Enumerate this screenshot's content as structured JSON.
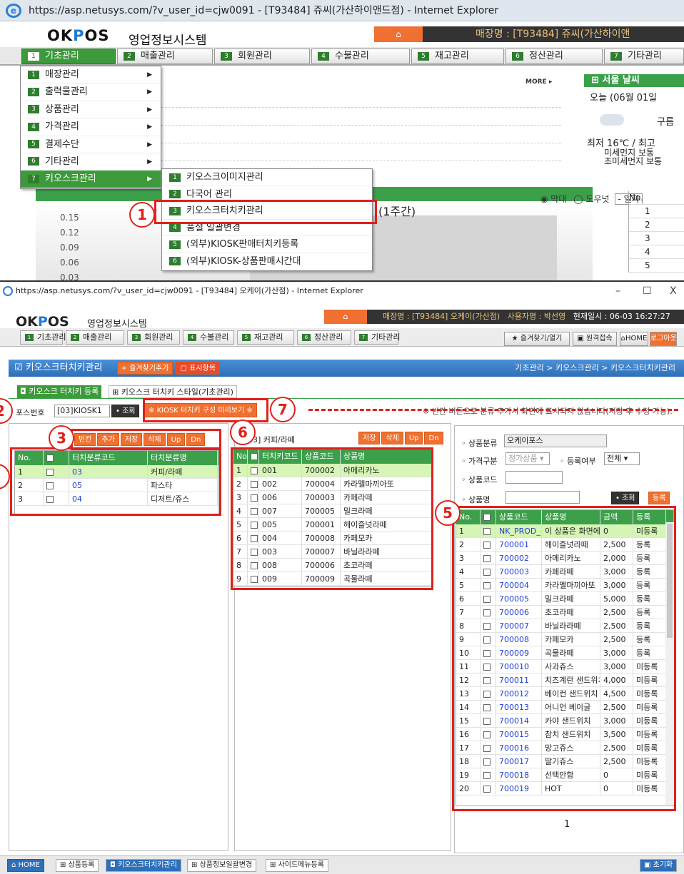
{
  "top_window": {
    "title": "https://asp.netusys.com/?v_user_id=cjw0091 - [T93484] 쥬씨(가산하이앤드점) - Internet Explorer",
    "logo_brand": "OKPOS",
    "logo_sub": "영업정보시스템",
    "store_label": "매장명 : [T93484] 쥬씨(가산하이앤",
    "menu": [
      {
        "num": "1",
        "label": "기초관리"
      },
      {
        "num": "2",
        "label": "매출관리"
      },
      {
        "num": "3",
        "label": "회원관리"
      },
      {
        "num": "4",
        "label": "수불관리"
      },
      {
        "num": "5",
        "label": "재고관리"
      },
      {
        "num": "6",
        "label": "정산관리"
      },
      {
        "num": "7",
        "label": "기타관리"
      }
    ],
    "dropdown": [
      {
        "num": "1",
        "label": "매장관리"
      },
      {
        "num": "2",
        "label": "출력물관리"
      },
      {
        "num": "3",
        "label": "상품관리"
      },
      {
        "num": "4",
        "label": "가격관리"
      },
      {
        "num": "5",
        "label": "결제수단"
      },
      {
        "num": "6",
        "label": "기타관리"
      },
      {
        "num": "7",
        "label": "키오스크관리"
      }
    ],
    "submenu": [
      {
        "num": "1",
        "label": "키오스크이미지관리"
      },
      {
        "num": "2",
        "label": "다국어 관리"
      },
      {
        "num": "3",
        "label": "키오스크터치키관리"
      },
      {
        "num": "4",
        "label": "품절 일괄변경"
      },
      {
        "num": "5",
        "label": "(외부)KIOSK판매터치키등록"
      },
      {
        "num": "6",
        "label": "(외부)KIOSK-상품판매시간대"
      }
    ],
    "more": "MORE ▸",
    "weather_title": "서울 날씨",
    "weather_today": "오늘 (06월 01일",
    "weather_desc": "구름",
    "weather_temp": "최저 16℃ / 최고",
    "weather_dust1": "미세먼지 보통",
    "weather_dust2": "초미세먼지 보통",
    "chart_title_fragment": "(1주간)",
    "chart_legend": [
      "막대",
      "도우넛",
      "- 일자"
    ],
    "mini_table_header": "No.",
    "mini_rows": [
      "1",
      "2",
      "3",
      "4",
      "5"
    ],
    "badge1": "1"
  },
  "chart_data": {
    "type": "bar",
    "title": "(1주간)",
    "ylim": [
      0,
      0.15
    ],
    "y_ticks": [
      "0.15",
      "0.12",
      "0.09",
      "0.06",
      "0.03"
    ],
    "categories": [],
    "values": []
  },
  "bottom_window": {
    "title": "https://asp.netusys.com/?v_user_id=cjw0091 - [T93484] 오케이(가산점) - Internet Explorer",
    "win_controls": [
      "–",
      "☐",
      "X"
    ],
    "logo_brand": "OKPOS",
    "logo_sub": "영업정보시스템",
    "store_text": "매장명 : [T93484] 오케이(가산점)",
    "user_text": "사용자명 : 박선영",
    "time_text": "현재일시 : 06-03 16:27:27",
    "menu": [
      {
        "num": "1",
        "label": "기초관리"
      },
      {
        "num": "2",
        "label": "매출관리"
      },
      {
        "num": "3",
        "label": "회원관리"
      },
      {
        "num": "4",
        "label": "수불관리"
      },
      {
        "num": "5",
        "label": "재고관리"
      },
      {
        "num": "6",
        "label": "정산관리"
      },
      {
        "num": "7",
        "label": "기타관리"
      }
    ],
    "right_buttons": [
      "즐겨찾기/열기",
      "원격접속",
      "HOME",
      "로그아웃"
    ],
    "page_title": "키오스크터치키관리",
    "add_favorite": "+ 즐겨찾기추가",
    "display_items": "표시항목",
    "breadcrumb": "기초관리 > 키오스크관리 > 키오스크터치키관리",
    "tabs": [
      "키오스크 터치키 등록",
      "키오스크 터치키 스타일(기초관리)"
    ],
    "pos_label": "포스번호",
    "pos_value": "[03]KIOSK1",
    "search_btn": "조회",
    "preview_btn": "KIOSK 터치키 구성 미리보기",
    "notice": "※ 빈칸 버튼으로 분류 추가시 화면에 표시되지 않습니다(저장 후 수정 가능).",
    "left_buttons": [
      "빈칸",
      "추가",
      "저장",
      "삭제",
      "Up",
      "Dn"
    ],
    "left_grid": {
      "headers": [
        "No.",
        "",
        "터치분류코드",
        "터치분류명"
      ],
      "rows": [
        {
          "no": "1",
          "code": "03",
          "name": "커피/라떼"
        },
        {
          "no": "2",
          "code": "05",
          "name": "파스타"
        },
        {
          "no": "3",
          "code": "04",
          "name": "디저트/쥬스"
        }
      ]
    },
    "mid_title": "03] 커피/라떼",
    "mid_buttons": [
      "저장",
      "삭제",
      "Up",
      "Dn"
    ],
    "mid_grid": {
      "headers": [
        "No.",
        "",
        "터치키코드",
        "상품코드",
        "상품명"
      ],
      "rows": [
        {
          "no": "1",
          "key": "001",
          "code": "700002",
          "name": "아메리카노"
        },
        {
          "no": "2",
          "key": "002",
          "code": "700004",
          "name": "카라멜마끼아또"
        },
        {
          "no": "3",
          "key": "006",
          "code": "700003",
          "name": "카페라떼"
        },
        {
          "no": "4",
          "key": "007",
          "code": "700005",
          "name": "밀크라떼"
        },
        {
          "no": "5",
          "key": "005",
          "code": "700001",
          "name": "헤이즐넛라떼"
        },
        {
          "no": "6",
          "key": "004",
          "code": "700008",
          "name": "카페모카"
        },
        {
          "no": "7",
          "key": "003",
          "code": "700007",
          "name": "바닐라라떼"
        },
        {
          "no": "8",
          "key": "008",
          "code": "700006",
          "name": "초코라떼"
        },
        {
          "no": "9",
          "key": "009",
          "code": "700009",
          "name": "곡물라떼"
        }
      ]
    },
    "filters": {
      "category_label": "상품분류",
      "category_value": "오케이포스",
      "price_label": "가격구분",
      "price_value": "정가상품",
      "reg_label": "등록여부",
      "reg_value": "전체",
      "code_label": "상품코드",
      "name_label": "상품명",
      "search_btn": "조회",
      "register_btn": "등록"
    },
    "right_grid": {
      "headers": [
        "No.",
        "",
        "상품코드",
        "상품명",
        "금액",
        "등록"
      ],
      "rows": [
        {
          "no": "1",
          "code": "NK_PROD_(",
          "name": "이 상품은 화면에",
          "price": "0",
          "reg": "미등록"
        },
        {
          "no": "2",
          "code": "700001",
          "name": "헤이즐넛라떼",
          "price": "2,500",
          "reg": "등록"
        },
        {
          "no": "3",
          "code": "700002",
          "name": "아메리카노",
          "price": "2,000",
          "reg": "등록"
        },
        {
          "no": "4",
          "code": "700003",
          "name": "카페라떼",
          "price": "3,000",
          "reg": "등록"
        },
        {
          "no": "5",
          "code": "700004",
          "name": "카라멜마끼아또",
          "price": "3,000",
          "reg": "등록"
        },
        {
          "no": "6",
          "code": "700005",
          "name": "밀크라떼",
          "price": "5,000",
          "reg": "등록"
        },
        {
          "no": "7",
          "code": "700006",
          "name": "초코라떼",
          "price": "2,500",
          "reg": "등록"
        },
        {
          "no": "8",
          "code": "700007",
          "name": "바닐라라떼",
          "price": "2,500",
          "reg": "등록"
        },
        {
          "no": "9",
          "code": "700008",
          "name": "카페모카",
          "price": "2,500",
          "reg": "등록"
        },
        {
          "no": "10",
          "code": "700009",
          "name": "곡물라떼",
          "price": "3,000",
          "reg": "등록"
        },
        {
          "no": "11",
          "code": "700010",
          "name": "사과쥬스",
          "price": "3,000",
          "reg": "미등록"
        },
        {
          "no": "12",
          "code": "700011",
          "name": "치즈계란 샌드위치",
          "price": "4,000",
          "reg": "미등록"
        },
        {
          "no": "13",
          "code": "700012",
          "name": "베이컨 샌드위치",
          "price": "4,500",
          "reg": "미등록"
        },
        {
          "no": "14",
          "code": "700013",
          "name": "어니언 베이글",
          "price": "2,500",
          "reg": "미등록"
        },
        {
          "no": "15",
          "code": "700014",
          "name": "카야 샌드위치",
          "price": "3,000",
          "reg": "미등록"
        },
        {
          "no": "16",
          "code": "700015",
          "name": "참치 샌드위치",
          "price": "3,500",
          "reg": "미등록"
        },
        {
          "no": "17",
          "code": "700016",
          "name": "망고쥬스",
          "price": "2,500",
          "reg": "미등록"
        },
        {
          "no": "18",
          "code": "700017",
          "name": "딸기쥬스",
          "price": "2,500",
          "reg": "미등록"
        },
        {
          "no": "19",
          "code": "700018",
          "name": "선택안함",
          "price": "0",
          "reg": "미등록"
        },
        {
          "no": "20",
          "code": "700019",
          "name": "HOT",
          "price": "0",
          "reg": "미등록"
        }
      ]
    },
    "pagination": "1",
    "bottom_tabs": [
      "HOME",
      "상품등록",
      "키오스크터치키관리",
      "상품정보일괄변경",
      "사이드메뉴등록"
    ],
    "reset_btn": "초기화",
    "badges": {
      "b2": "2",
      "b3": "3",
      "b5": "5",
      "b6": "6",
      "b7": "7"
    }
  },
  "colors": {
    "accent_green": "#3ca04a",
    "accent_orange": "#ef7030",
    "annotation_red": "#e0201a",
    "title_blue": "#2e6fb8"
  }
}
